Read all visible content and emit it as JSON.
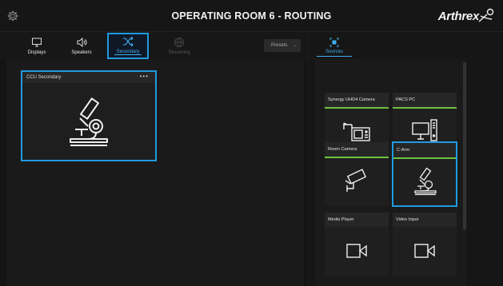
{
  "header": {
    "title": "OPERATING ROOM 6 - ROUTING",
    "brand": "Arthrex",
    "settings_icon": "gear-icon",
    "brand_icon": "arthrex-logo-icon"
  },
  "tabs": [
    {
      "label": "Displays",
      "icon": "monitor-icon",
      "state": "normal"
    },
    {
      "label": "Speakers",
      "icon": "speaker-icon",
      "state": "normal"
    },
    {
      "label": "Secondary",
      "icon": "shuffle-icon",
      "state": "active"
    },
    {
      "label": "Streaming",
      "icon": "globe-icon",
      "state": "disabled"
    }
  ],
  "presets": {
    "label": "Presets",
    "icon": "chevron-down-icon"
  },
  "destination": {
    "name": "CCU Secondary",
    "menu": "•••",
    "icon": "microscope-icon"
  },
  "sources_tab": {
    "label": "Sources",
    "icon": "source-target-icon"
  },
  "sources": [
    {
      "name": "Synergy UHD4 Camera",
      "icon": "camera-console-icon",
      "active_bar": true,
      "selected": false
    },
    {
      "name": "PACS PC",
      "icon": "desktop-pc-icon",
      "active_bar": true,
      "selected": false
    },
    {
      "name": "Room Camera",
      "icon": "security-camera-icon",
      "active_bar": true,
      "selected": false
    },
    {
      "name": "C-Arm",
      "icon": "microscope-icon",
      "active_bar": true,
      "selected": true
    },
    {
      "name": "Media Player",
      "icon": "video-camera-icon",
      "active_bar": false,
      "selected": false
    },
    {
      "name": "Video Input",
      "icon": "video-camera-icon",
      "active_bar": false,
      "selected": false
    }
  ],
  "colors": {
    "accent": "#1e9be0",
    "live": "#6fc13d",
    "background": "#121212"
  }
}
